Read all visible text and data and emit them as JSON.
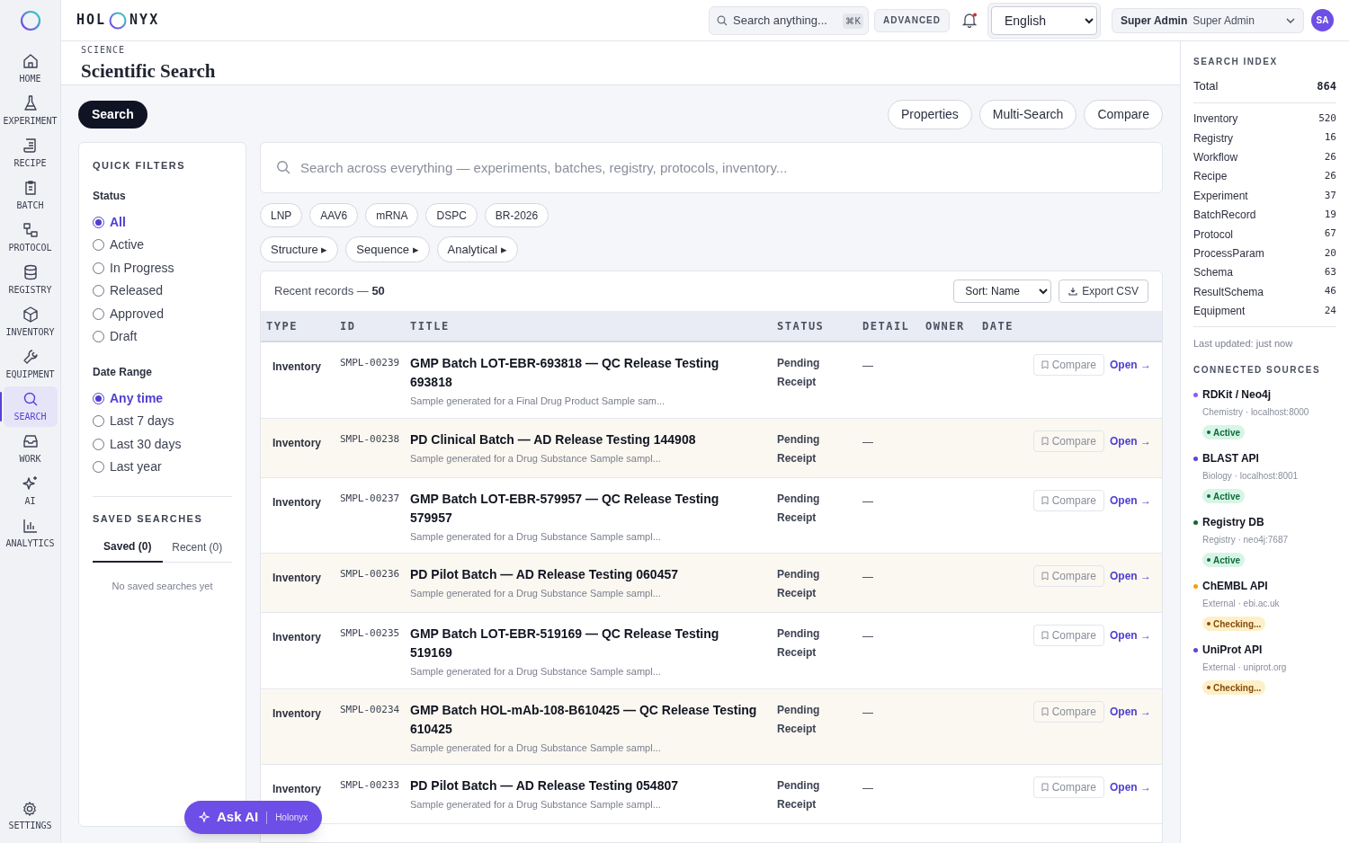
{
  "brand": {
    "left": "HOL",
    "right": "NYX"
  },
  "topbar": {
    "search_placeholder": "Search anything...",
    "shortcut": "⌘K",
    "advanced": "ADVANCED",
    "language": "English",
    "user_name": "Super Admin",
    "user_role": "Super Admin",
    "avatar": "SA"
  },
  "sidebar": {
    "items": [
      {
        "label": "HOME",
        "selected": false
      },
      {
        "label": "EXPERIMENT",
        "selected": false
      },
      {
        "label": "RECIPE",
        "selected": false
      },
      {
        "label": "BATCH",
        "selected": false
      },
      {
        "label": "PROTOCOL",
        "selected": false
      },
      {
        "label": "REGISTRY",
        "selected": false
      },
      {
        "label": "INVENTORY",
        "selected": false
      },
      {
        "label": "EQUIPMENT",
        "selected": false
      },
      {
        "label": "SEARCH",
        "selected": true
      },
      {
        "label": "WORK",
        "selected": false
      },
      {
        "label": "AI",
        "selected": false
      },
      {
        "label": "ANALYTICS",
        "selected": false
      }
    ],
    "settings": "SETTINGS"
  },
  "header": {
    "breadcrumb": "SCIENCE",
    "title": "Scientific Search"
  },
  "toolbar": {
    "primary": "Search",
    "buttons": [
      "Properties",
      "Multi-Search",
      "Compare"
    ]
  },
  "filters": {
    "title": "QUICK FILTERS",
    "groups": [
      {
        "label": "Status",
        "options": [
          {
            "label": "All",
            "selected": true
          },
          {
            "label": "Active",
            "selected": false
          },
          {
            "label": "In Progress",
            "selected": false
          },
          {
            "label": "Released",
            "selected": false
          },
          {
            "label": "Approved",
            "selected": false
          },
          {
            "label": "Draft",
            "selected": false
          }
        ]
      },
      {
        "label": "Date Range",
        "options": [
          {
            "label": "Any time",
            "selected": true
          },
          {
            "label": "Last 7 days",
            "selected": false
          },
          {
            "label": "Last 30 days",
            "selected": false
          },
          {
            "label": "Last year",
            "selected": false
          }
        ]
      }
    ],
    "saved": {
      "title": "SAVED SEARCHES",
      "tabs": [
        {
          "label": "Saved (0)",
          "selected": true
        },
        {
          "label": "Recent (0)",
          "selected": false
        }
      ],
      "empty": "No saved searches yet"
    }
  },
  "search": {
    "placeholder": "Search across everything — experiments, batches, registry, protocols, inventory..."
  },
  "tags": [
    "LNP",
    "AAV6",
    "mRNA",
    "DSPC",
    "BR-2026"
  ],
  "modes": [
    "Structure ▸",
    "Sequence ▸",
    "Analytical ▸"
  ],
  "records": {
    "label": "Recent records —",
    "count": "50",
    "sort": "Sort: Name",
    "export": "Export CSV",
    "columns": [
      "TYPE",
      "ID",
      "TITLE",
      "STATUS",
      "DETAIL",
      "OWNER",
      "DATE"
    ],
    "rows": [
      {
        "type": "Inventory",
        "id": "SMPL-00239",
        "title": "GMP Batch LOT-EBR-693818 — QC Release Testing 693818",
        "subtitle": "Sample generated for a Final Drug Product Sample sam...",
        "status": "Pending Receipt",
        "detail": "—",
        "compare": "Compare",
        "open": "Open →"
      },
      {
        "type": "Inventory",
        "id": "SMPL-00238",
        "title": "PD Clinical Batch — AD Release Testing 144908",
        "subtitle": "Sample generated for a Drug Substance Sample sampl...",
        "status": "Pending Receipt",
        "detail": "—",
        "compare": "Compare",
        "open": "Open →"
      },
      {
        "type": "Inventory",
        "id": "SMPL-00237",
        "title": "GMP Batch LOT-EBR-579957 — QC Release Testing 579957",
        "subtitle": "Sample generated for a Drug Substance Sample sampl...",
        "status": "Pending Receipt",
        "detail": "—",
        "compare": "Compare",
        "open": "Open →"
      },
      {
        "type": "Inventory",
        "id": "SMPL-00236",
        "title": "PD Pilot Batch — AD Release Testing 060457",
        "subtitle": "Sample generated for a Drug Substance Sample sampl...",
        "status": "Pending Receipt",
        "detail": "—",
        "compare": "Compare",
        "open": "Open →"
      },
      {
        "type": "Inventory",
        "id": "SMPL-00235",
        "title": "GMP Batch LOT-EBR-519169 — QC Release Testing 519169",
        "subtitle": "Sample generated for a Drug Substance Sample sampl...",
        "status": "Pending Receipt",
        "detail": "—",
        "compare": "Compare",
        "open": "Open →"
      },
      {
        "type": "Inventory",
        "id": "SMPL-00234",
        "title": "GMP Batch HOL-mAb-108-B610425 — QC Release Testing 610425",
        "subtitle": "Sample generated for a Drug Substance Sample sampl...",
        "status": "Pending Receipt",
        "detail": "—",
        "compare": "Compare",
        "open": "Open →"
      },
      {
        "type": "Inventory",
        "id": "SMPL-00233",
        "title": "PD Pilot Batch — AD Release Testing 054807",
        "subtitle": "Sample generated for a Drug Substance Sample sampl...",
        "status": "Pending Receipt",
        "detail": "—",
        "compare": "Compare",
        "open": "Open →"
      }
    ]
  },
  "index": {
    "title": "SEARCH INDEX",
    "total_label": "Total",
    "total": "864",
    "items": [
      {
        "label": "Inventory",
        "count": "520"
      },
      {
        "label": "Registry",
        "count": "16"
      },
      {
        "label": "Workflow",
        "count": "26"
      },
      {
        "label": "Recipe",
        "count": "26"
      },
      {
        "label": "Experiment",
        "count": "37"
      },
      {
        "label": "BatchRecord",
        "count": "19"
      },
      {
        "label": "Protocol",
        "count": "67"
      },
      {
        "label": "ProcessParam",
        "count": "20"
      },
      {
        "label": "Schema",
        "count": "63"
      },
      {
        "label": "ResultSchema",
        "count": "46"
      },
      {
        "label": "Equipment",
        "count": "24"
      }
    ],
    "updated": "Last updated: just now"
  },
  "sources": {
    "title": "CONNECTED SOURCES",
    "items": [
      {
        "name": "RDKit / Neo4j",
        "detail": "Chemistry · localhost:8000",
        "color": "#8b5cf6",
        "status": "Active",
        "kind": "active"
      },
      {
        "name": "BLAST API",
        "detail": "Biology · localhost:8001",
        "color": "#5b47d6",
        "status": "Active",
        "kind": "active"
      },
      {
        "name": "Registry DB",
        "detail": "Registry · neo4j:7687",
        "color": "#166534",
        "status": "Active",
        "kind": "active"
      },
      {
        "name": "ChEMBL API",
        "detail": "External · ebi.ac.uk",
        "color": "#f59e0b",
        "status": "Checking...",
        "kind": "checking"
      },
      {
        "name": "UniProt API",
        "detail": "External · uniprot.org",
        "color": "#5b47d6",
        "status": "Checking...",
        "kind": "checking"
      }
    ]
  },
  "ask_ai": {
    "label": "Ask AI",
    "brand": "Holonyx"
  }
}
